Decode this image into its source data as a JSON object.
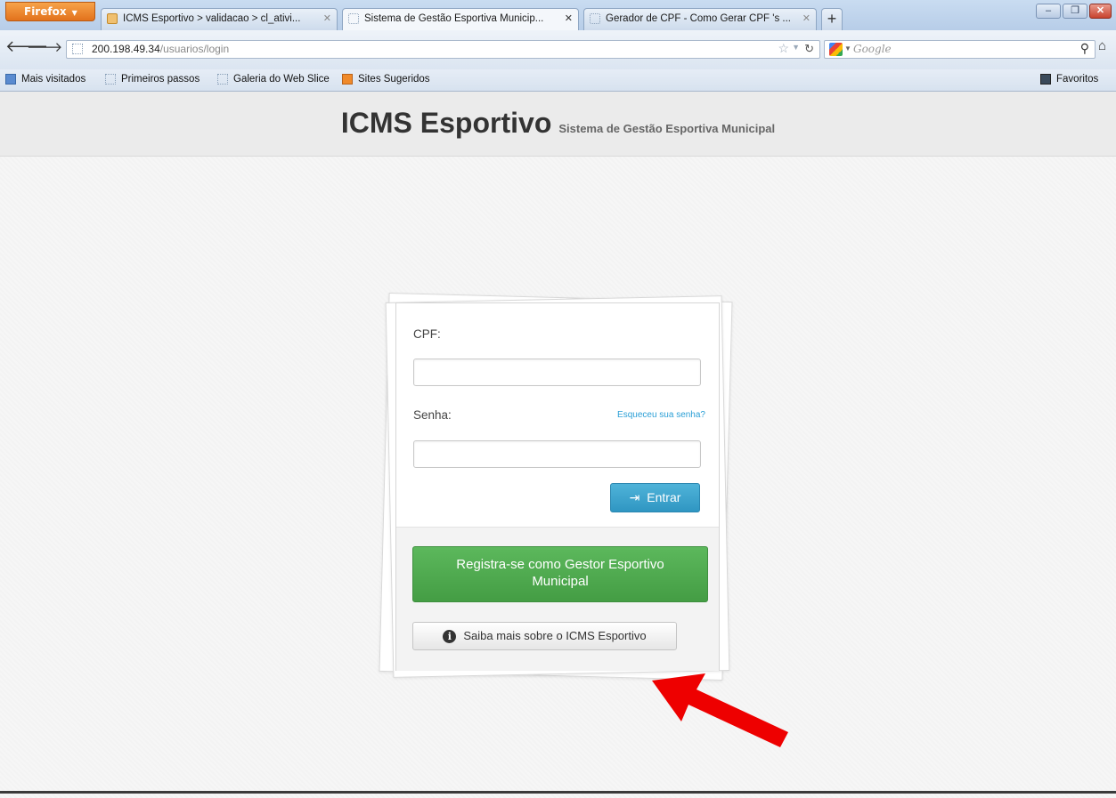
{
  "browser": {
    "menu_button": "Firefox",
    "tabs": [
      {
        "title": "ICMS Esportivo > validacao > cl_ativi...",
        "active": false
      },
      {
        "title": "Sistema de Gestão Esportiva Municip...",
        "active": true
      },
      {
        "title": "Gerador de CPF - Como Gerar CPF 's ...",
        "active": false
      }
    ],
    "new_tab_label": "+",
    "url_host": "200.198.49.34",
    "url_path": "/usuarios/login",
    "search_placeholder": "Google",
    "bookmarks": [
      "Mais visitados",
      "Primeiros passos",
      "Galeria do Web Slice",
      "Sites Sugeridos"
    ],
    "favorites": "Favoritos"
  },
  "header": {
    "title": "ICMS Esportivo",
    "subtitle": "Sistema de Gestão Esportiva Municipal"
  },
  "login": {
    "cpf_label": "CPF:",
    "cpf_value": "",
    "senha_label": "Senha:",
    "senha_value": "",
    "forgot_link": "Esqueceu sua senha?",
    "submit_label": "Entrar",
    "register_label": "Registra-se como Gestor Esportivo Municipal",
    "about_label": "Saiba mais sobre o ICMS Esportivo"
  },
  "colors": {
    "entrar": "#2f96c2",
    "register": "#5cb85c",
    "arrow": "#ee0000"
  },
  "icons": {
    "submit": "sign-in-icon",
    "about": "info-circle-icon",
    "annotation": "red-arrow"
  }
}
